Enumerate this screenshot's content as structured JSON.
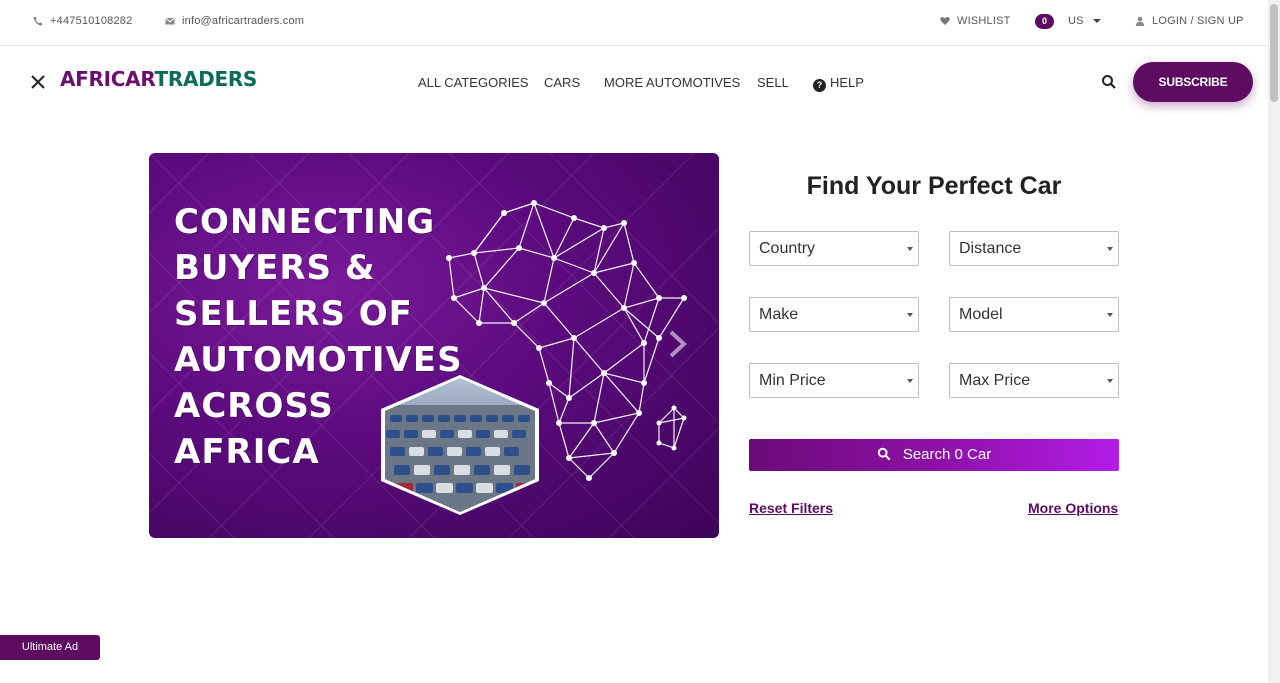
{
  "topbar": {
    "phone": "+447510108282",
    "email": "info@africartraders.com",
    "wishlist_label": "WISHLIST",
    "wishlist_count": "0",
    "currency": "US",
    "login_label": "LOGIN / SIGN UP"
  },
  "header": {
    "logo_part1": "AFRICAR",
    "logo_part2": "TRADERS",
    "nav": [
      "ALL CATEGORIES",
      "CARS",
      "MORE AUTOMOTIVES",
      "SELL",
      "HELP"
    ],
    "subscribe_label": "SUBSCRIBE"
  },
  "hero": {
    "lines": [
      "CONNECTING",
      "BUYERS &",
      "SELLERS OF",
      "AUTOMOTIVES",
      "ACROSS",
      "AFRICA"
    ]
  },
  "search_panel": {
    "title": "Find Your Perfect Car",
    "selects": {
      "country": "Country",
      "distance": "Distance",
      "make": "Make",
      "model": "Model",
      "min_price": "Min Price",
      "max_price": "Max Price"
    },
    "search_label": "Search 0 Car",
    "reset_label": "Reset Filters",
    "more_label": "More Options"
  },
  "footer_badge": "Ultimate Ad",
  "colors": {
    "brand_purple": "#5c0b61",
    "brand_green": "#0c6b5a"
  }
}
